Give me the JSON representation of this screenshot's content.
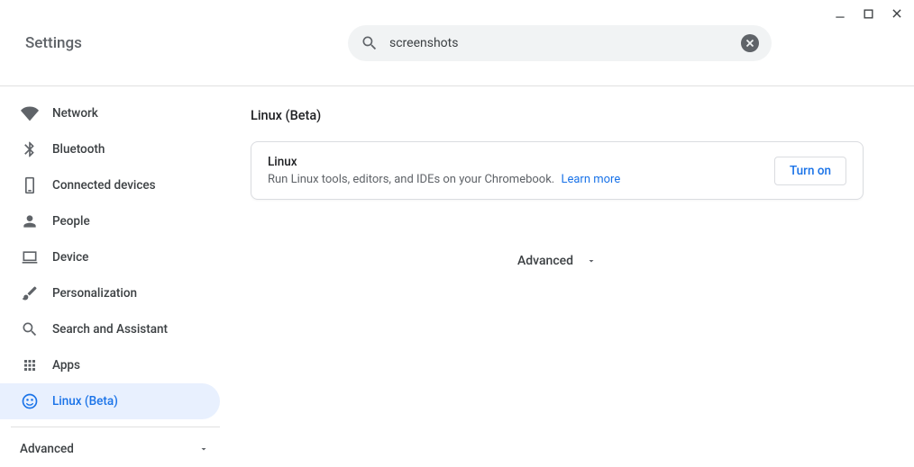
{
  "window": {
    "title": "Settings"
  },
  "search": {
    "value": "screenshots"
  },
  "sidebar": {
    "items": [
      {
        "label": "Network"
      },
      {
        "label": "Bluetooth"
      },
      {
        "label": "Connected devices"
      },
      {
        "label": "People"
      },
      {
        "label": "Device"
      },
      {
        "label": "Personalization"
      },
      {
        "label": "Search and Assistant"
      },
      {
        "label": "Apps"
      },
      {
        "label": "Linux (Beta)"
      }
    ],
    "advanced_label": "Advanced"
  },
  "main": {
    "section_title": "Linux (Beta)",
    "card": {
      "title": "Linux",
      "description": "Run Linux tools, editors, and IDEs on your Chromebook.",
      "learn_more": "Learn more",
      "action_label": "Turn on"
    },
    "advanced_toggle": "Advanced"
  }
}
